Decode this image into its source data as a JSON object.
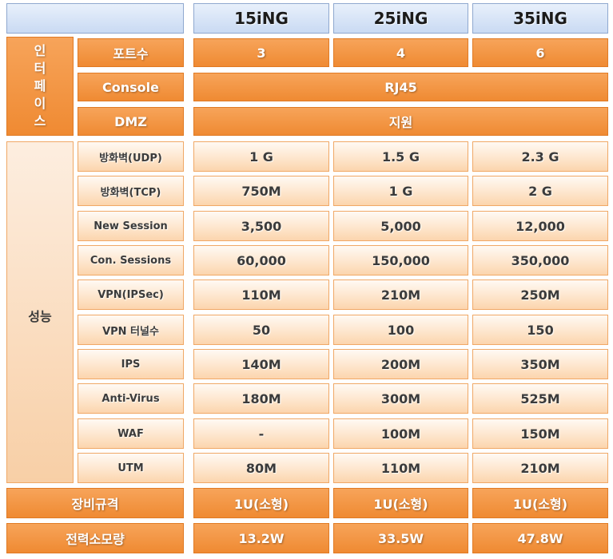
{
  "models": [
    "15iNG",
    "25iNG",
    "35iNG"
  ],
  "interface": {
    "section_label_chars": [
      "인",
      "터",
      "페",
      "이",
      "스"
    ],
    "ports": {
      "label": "포트수",
      "values": [
        "3",
        "4",
        "6"
      ]
    },
    "console": {
      "label": "Console",
      "value": "RJ45"
    },
    "dmz": {
      "label": "DMZ",
      "value": "지원"
    }
  },
  "performance": {
    "section_label": "성능",
    "rows": [
      {
        "label": "방화벽(UDP)",
        "values": [
          "1 G",
          "1.5 G",
          "2.3 G"
        ]
      },
      {
        "label": "방화벽(TCP)",
        "values": [
          "750M",
          "1 G",
          "2 G"
        ]
      },
      {
        "label": "New Session",
        "values": [
          "3,500",
          "5,000",
          "12,000"
        ]
      },
      {
        "label": "Con. Sessions",
        "values": [
          "60,000",
          "150,000",
          "350,000"
        ]
      },
      {
        "label": "VPN(IPSec)",
        "values": [
          "110M",
          "210M",
          "250M"
        ]
      },
      {
        "label": "VPN 터널수",
        "values": [
          "50",
          "100",
          "150"
        ]
      },
      {
        "label": "IPS",
        "values": [
          "140M",
          "200M",
          "350M"
        ]
      },
      {
        "label": "Anti-Virus",
        "values": [
          "180M",
          "300M",
          "525M"
        ]
      },
      {
        "label": "WAF",
        "values": [
          "-",
          "100M",
          "150M"
        ]
      },
      {
        "label": "UTM",
        "values": [
          "80M",
          "110M",
          "210M"
        ]
      }
    ]
  },
  "spec": {
    "label": "장비규격",
    "values": [
      "1U(소형)",
      "1U(소형)",
      "1U(소형)"
    ]
  },
  "power": {
    "label": "전력소모량",
    "values": [
      "13.2W",
      "33.5W",
      "47.8W"
    ]
  },
  "colors": {
    "orange": "#ef8a32",
    "light_orange": "#fcd5ad",
    "header_blue": "#c9daf3"
  }
}
